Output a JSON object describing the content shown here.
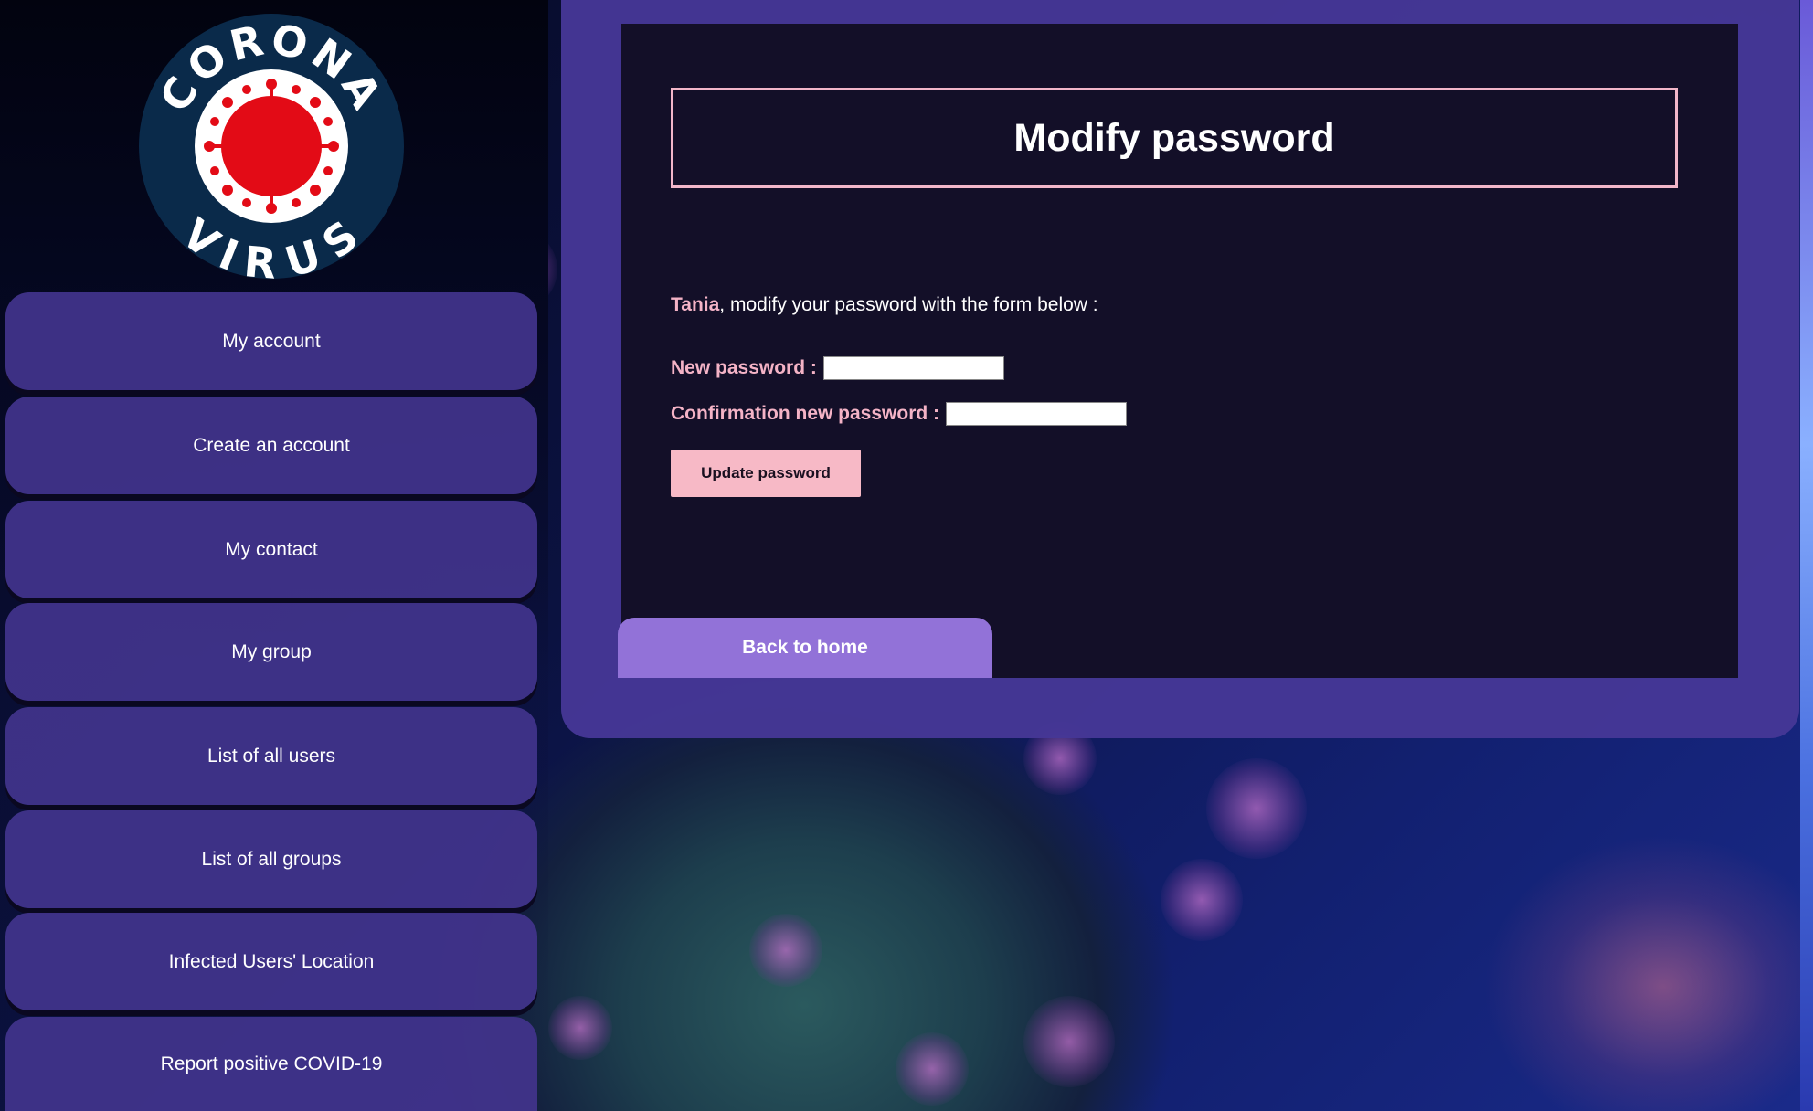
{
  "logo": {
    "word_top": "CORONA",
    "word_bottom": "VIRUS",
    "colors": {
      "ring": "#0a2a4a",
      "inner": "#ffffff",
      "virus": "#e30b16"
    }
  },
  "sidebar": {
    "items": [
      {
        "label": "My account"
      },
      {
        "label": "Create an account"
      },
      {
        "label": "My contact"
      },
      {
        "label": "My group"
      },
      {
        "label": "List of all users"
      },
      {
        "label": "List of all groups"
      },
      {
        "label": "Infected Users' Location"
      },
      {
        "label": "Report positive COVID-19"
      }
    ]
  },
  "main": {
    "title": "Modify password",
    "intro": {
      "user_name": "Tania",
      "text": ", modify your password with the form below :"
    },
    "new_password_label": "New password :",
    "new_password_value": "",
    "confirm_password_label": "Confirmation new password :",
    "confirm_password_value": "",
    "update_button": "Update password",
    "back_button": "Back to home"
  },
  "colors": {
    "accent_pink": "#f4b3c6",
    "panel_purple": "#46379a",
    "content_dark": "#130f28",
    "back_button": "#9272d8"
  }
}
